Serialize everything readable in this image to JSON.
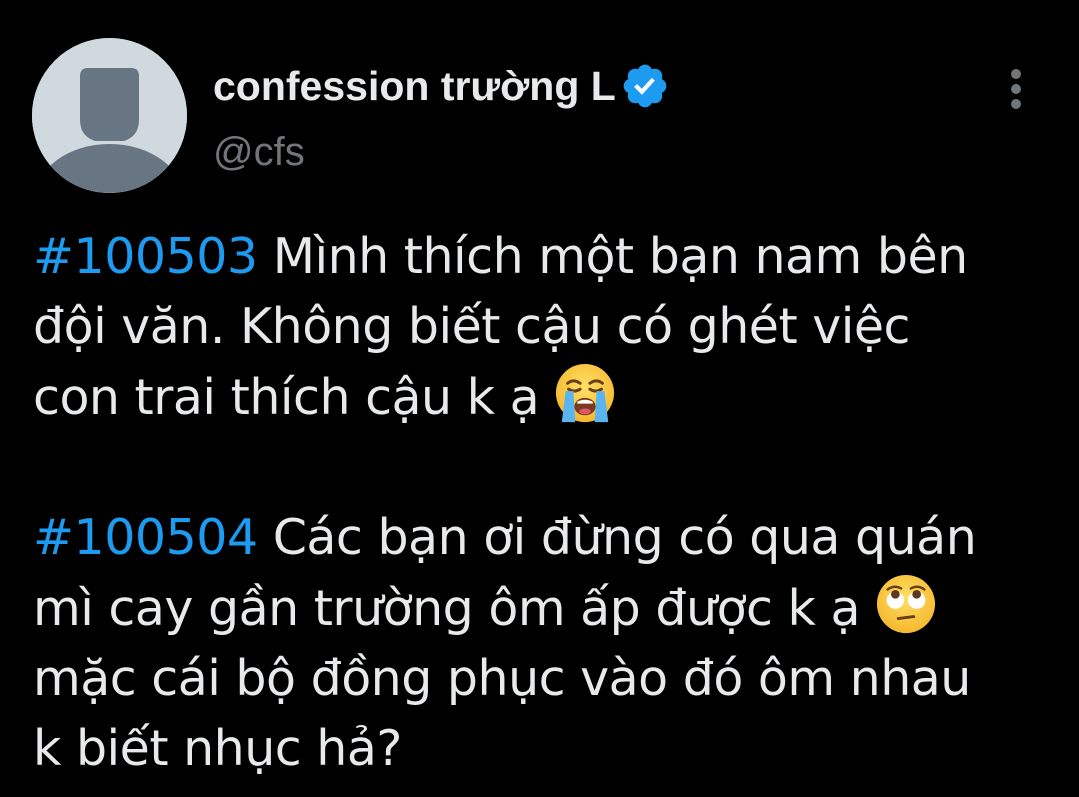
{
  "profile": {
    "display_name": "confession trường L",
    "handle": "@cfs",
    "verified": true,
    "verified_color": "#1d9bf0",
    "avatar_color": "#cfd9de",
    "avatar_silhouette_color": "#687684"
  },
  "menu": {
    "icon": "more-vertical-icon"
  },
  "tweet": {
    "hashtag_color": "#1d9bf0",
    "text_color": "#e7e9ea",
    "paragraphs": [
      {
        "hashtag": "#100503",
        "lines": [
          "Mình thích một bạn nam bên",
          "đội văn. Không biết cậu có ghét việc",
          "con trai thích cậu k ạ"
        ],
        "emoji": "loudly-crying-face-icon"
      },
      {
        "hashtag": "#100504",
        "lines": [
          "Các bạn ơi đừng có qua quán",
          "mì cay gần trường ôm ấp được k ạ",
          "mặc cái bộ đồng phục vào đó ôm nhau",
          "k biết nhục hả?"
        ],
        "emoji": "face-with-rolling-eyes-icon"
      }
    ]
  },
  "theme": {
    "background": "#000000",
    "secondary_text": "#71767b"
  }
}
